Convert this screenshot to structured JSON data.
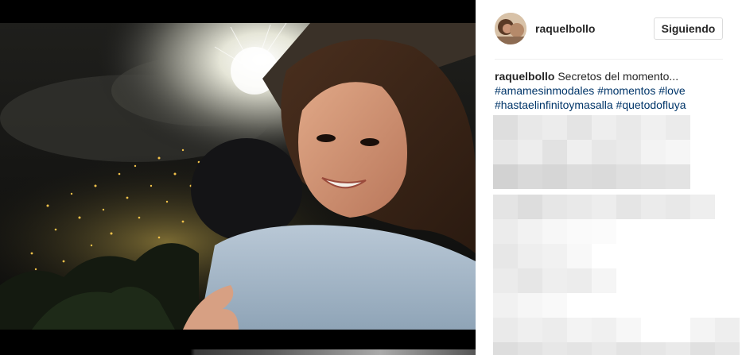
{
  "post": {
    "username": "raquelbollo",
    "follow_label": "Siguiendo",
    "caption": {
      "author": "raquelbollo",
      "text": "Secretos del momento...",
      "hashtags": [
        "#amamesinmodales",
        "#momentos",
        "#love",
        "#hastaelinfinitoymasalla",
        "#quetodofluya"
      ]
    }
  },
  "icons": {
    "avatar": "profile-photo",
    "photo": "fireworks-selfie-photo"
  },
  "colors": {
    "hashtag": "#003569",
    "text": "#262626",
    "button_border": "#dbdbdb",
    "divider": "#efefef"
  }
}
